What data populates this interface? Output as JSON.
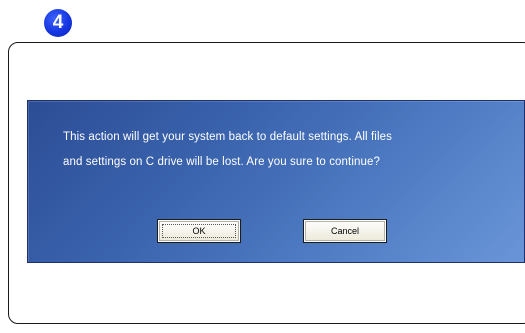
{
  "step": {
    "number": "4",
    "badge_color": "#1536e0"
  },
  "dialog": {
    "background_color": "#3a63ad",
    "message_lines": [
      "This action will get your system back to default settings. All files",
      "and settings on C drive will be lost. Are you sure to continue?"
    ],
    "ok_label": "OK",
    "cancel_label": "Cancel"
  }
}
